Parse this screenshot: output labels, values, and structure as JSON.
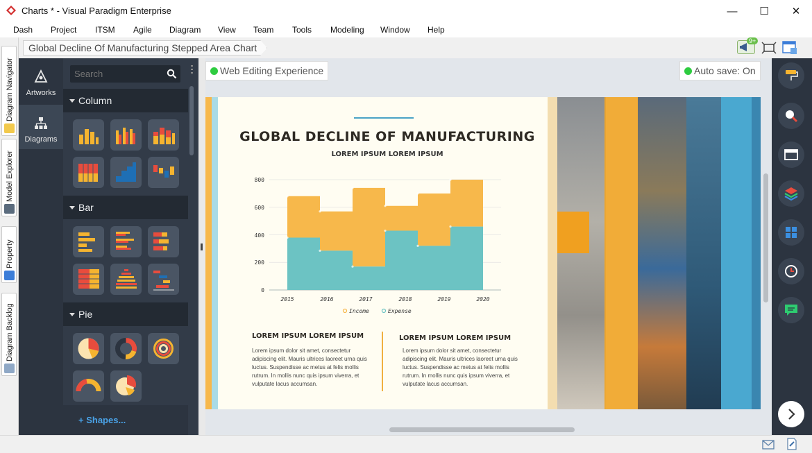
{
  "window": {
    "title": "Charts * - Visual Paradigm Enterprise",
    "minimize": "—",
    "maximize": "☐",
    "close": "✕"
  },
  "menu": [
    "Dash",
    "Project",
    "ITSM",
    "Agile",
    "Diagram",
    "View",
    "Team",
    "Tools",
    "Modeling",
    "Window",
    "Help"
  ],
  "breadcrumb": "Global Decline Of Manufacturing Stepped Area Chart",
  "notification_badge": "9+",
  "left_tabs": [
    "Diagram Navigator",
    "Model Explorer",
    "Property",
    "Diagram Backlog"
  ],
  "nav": {
    "artworks": "Artworks",
    "diagrams": "Diagrams"
  },
  "search": {
    "placeholder": "Search"
  },
  "sections": {
    "column": "Column",
    "bar": "Bar",
    "pie": "Pie"
  },
  "shapes_link": "+ Shapes...",
  "web_editing": "Web Editing Experience",
  "autosave": "Auto save: On",
  "poster": {
    "title": "GLOBAL DECLINE OF MANUFACTURING",
    "subtitle": "LOREM IPSUM LOREM IPSUM",
    "col1_head": "LOREM IPSUM LOREM IPSUM",
    "col1_body": "Lorem ipsum dolor sit amet, consectetur adipiscing elit. Mauris ultrices laoreet urna quis luctus. Suspendisse ac metus at felis mollis rutrum. In mollis nunc quis ipsum viverra, et vulputate lacus accumsan.",
    "col2_head": "LOREM IPSUM LOREM IPSUM",
    "col2_body": "Lorem ipsum dolor sit amet, consectetur adipiscing elit. Mauris ultrices laoreet urna quis luctus. Suspendisse ac metus at felis mollis rutrum. In mollis nunc quis ipsum viverra, et vulputate lacus accumsan."
  },
  "chart_data": {
    "type": "area",
    "step": true,
    "x": [
      "2015",
      "2016",
      "2017",
      "2018",
      "2019",
      "2020"
    ],
    "ylim": [
      0,
      800
    ],
    "yticks": [
      "0",
      "200",
      "400",
      "600",
      "800"
    ],
    "grid": true,
    "legend_position": "bottom",
    "series": [
      {
        "name": "Income",
        "color": "#f7b84b",
        "values": [
          680,
          570,
          740,
          610,
          700,
          800
        ]
      },
      {
        "name": "Expense",
        "color": "#6cc3c3",
        "values": [
          380,
          285,
          170,
          430,
          320,
          460
        ]
      }
    ]
  },
  "colors": {
    "accent_orange": "#f7b84b",
    "accent_teal": "#6cc3c3",
    "panel_dark": "#2c3440",
    "status_green": "#2ecc40"
  }
}
